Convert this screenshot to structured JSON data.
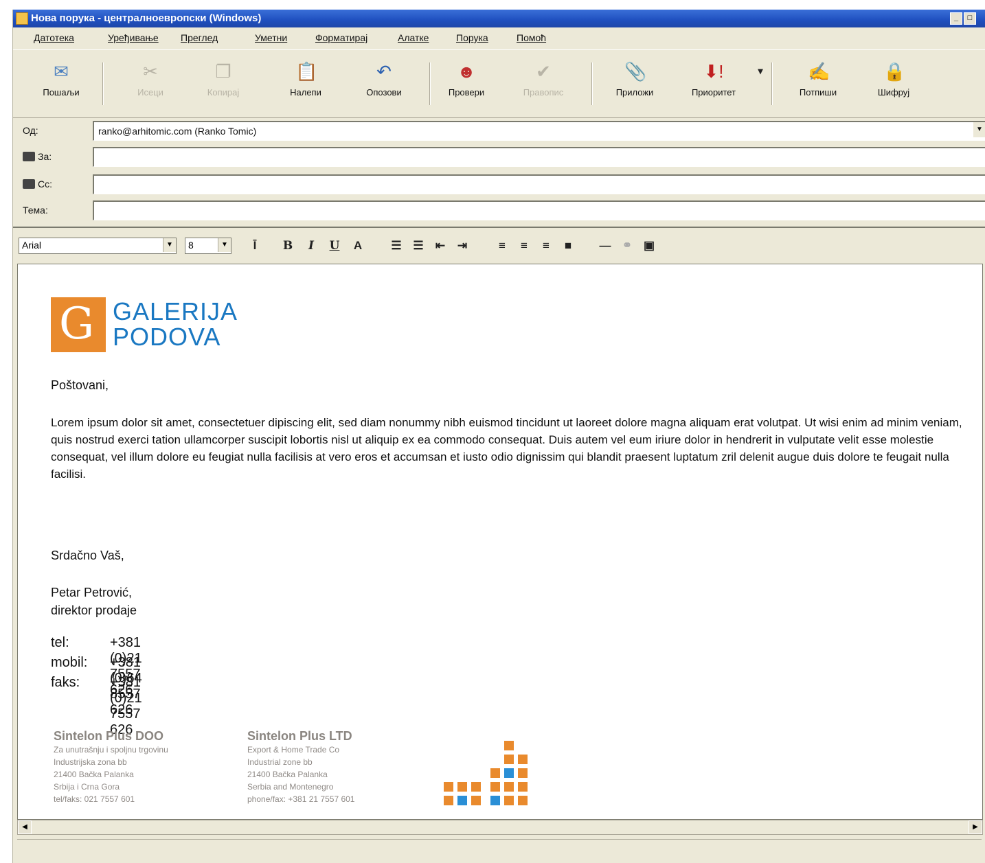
{
  "window": {
    "title": "Нова порука - централноевропски (Windows)"
  },
  "menu": [
    "Датотека",
    "Уређивање",
    "Преглед",
    "Уметни",
    "Форматирај",
    "Алатке",
    "Порука",
    "Помоћ"
  ],
  "toolbar": {
    "send": "Пошаљи",
    "cut": "Исеци",
    "copy": "Копирај",
    "paste": "Налепи",
    "undo": "Опозови",
    "check": "Провери",
    "spelling": "Правопис",
    "attach": "Приложи",
    "priority": "Приоритет",
    "sign": "Потпиши",
    "encrypt": "Шифруј"
  },
  "header": {
    "from_label": "Од:",
    "from_value": "ranko@arhitomic.com   (Ranko Tomic)",
    "to_label": "За:",
    "cc_label": "Cc:",
    "subject_label": "Тема:"
  },
  "format": {
    "font": "Arial",
    "size": "8"
  },
  "message": {
    "logo_line1": "GALERIJA",
    "logo_line2": "PODOVA",
    "greeting": "Poštovani,",
    "body": "Lorem ipsum dolor sit amet, consectetuer dipiscing elit, sed diam nonummy nibh euismod tincidunt ut laoreet dolore magna aliquam erat volutpat. Ut wisi enim ad minim veniam, quis nostrud exerci tation ullamcorper suscipit lobortis nisl ut aliquip ex ea commodo consequat. Duis autem vel eum iriure dolor in hendrerit in vulputate velit esse molestie consequat, vel illum dolore eu feugiat nulla facilisis at vero eros et accumsan et iusto odio dignissim qui blandit praesent luptatum zril delenit augue duis dolore te feugait nulla facilisi.",
    "closing": "Srdačno Vaš,",
    "name": "Petar Petrović,",
    "role": "direktor prodaje",
    "contacts": [
      {
        "k": "tel:",
        "v": "+381 (0)21 7557 626"
      },
      {
        "k": "mobil:",
        "v": "+381 (0)64 8557 626"
      },
      {
        "k": "faks:",
        "v": "+381 (0)21 7557 626"
      }
    ],
    "company_doo": {
      "name": "Sintelon Plus DOO",
      "lines": [
        "Za unutrašnju i spoljnu trgovinu",
        "Industrijska zona bb",
        "21400 Bačka Palanka",
        "Srbija i Crna Gora",
        "tel/faks: 021 7557 601"
      ]
    },
    "company_ltd": {
      "name": "Sintelon Plus LTD",
      "lines": [
        "Export & Home Trade Co",
        "Industrial zone bb",
        "21400 Bačka Palanka",
        "Serbia and Montenegro",
        "phone/fax: +381 21 7557 601"
      ]
    }
  },
  "colors": {
    "accent_orange": "#e98a2d",
    "accent_blue": "#1a78c2"
  }
}
